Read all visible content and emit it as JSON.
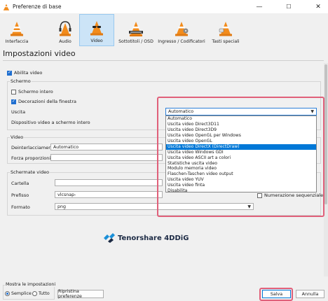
{
  "window": {
    "title": "Preferenze di base",
    "minimize": "—",
    "maximize": "☐",
    "close": "✕"
  },
  "toolbar": {
    "items": [
      {
        "label": "Interfaccia",
        "icon": "vlc-cone-icon"
      },
      {
        "label": "Audio",
        "icon": "headphones-cone-icon"
      },
      {
        "label": "Video",
        "icon": "sunglasses-cone-icon"
      },
      {
        "label": "Sottotitoli / OSD",
        "icon": "subtitles-cone-icon"
      },
      {
        "label": "Ingresso / Codificatori",
        "icon": "input-cone-icon"
      },
      {
        "label": "Tasti speciali",
        "icon": "hotkeys-cone-icon"
      }
    ]
  },
  "header": {
    "title": "Impostazioni video"
  },
  "video": {
    "enable_label": "Abilita video",
    "screen_group": "Schermo",
    "fullscreen_label": "Schermo intero",
    "decorations_label": "Decorazioni della finestra",
    "output_label": "Uscita",
    "output_value": "Automatico",
    "fullscreen_device_label": "Dispositivo video a schermo intero",
    "video_group": "Video",
    "deinterlace_label": "Deinterlacciamento",
    "deinterlace_value": "Automatico",
    "force_aspect_label": "Forza proporzioni",
    "snapshots_group": "Schermate video",
    "folder_label": "Cartella",
    "prefix_label": "Prefisso",
    "prefix_value": "vlcsnap-",
    "sequential_label": "Numerazione sequenziale",
    "format_label": "Formato",
    "format_value": "png"
  },
  "dropdown": {
    "selected_index": 6,
    "options": [
      "Automatico",
      "Uscita video Direct3D11",
      "Uscita video Direct3D9",
      "Uscita video OpenGL per Windows",
      "Uscita video OpenGL",
      "Uscita video DirectX (DirectDraw)",
      "Uscita video Windows GDI",
      "Uscita video ASCII art a colori",
      "Statistiche uscita video",
      "Modulo memoria video",
      "Flaschen-Taschen video output",
      "Uscita video YUV",
      "Uscita video finta",
      "Disabilita"
    ]
  },
  "watermark": {
    "text": "Tenorshare 4DDiG"
  },
  "footer": {
    "show_settings_label": "Mostra le impostazioni",
    "simple_label": "Semplice",
    "all_label": "Tutto",
    "reset_label": "Ripristina preferenze",
    "save_label": "Salva",
    "cancel_label": "Annulla"
  },
  "colors": {
    "accent": "#0078d7",
    "highlight_box": "#e0607a",
    "cone_orange": "#f28c1d"
  }
}
